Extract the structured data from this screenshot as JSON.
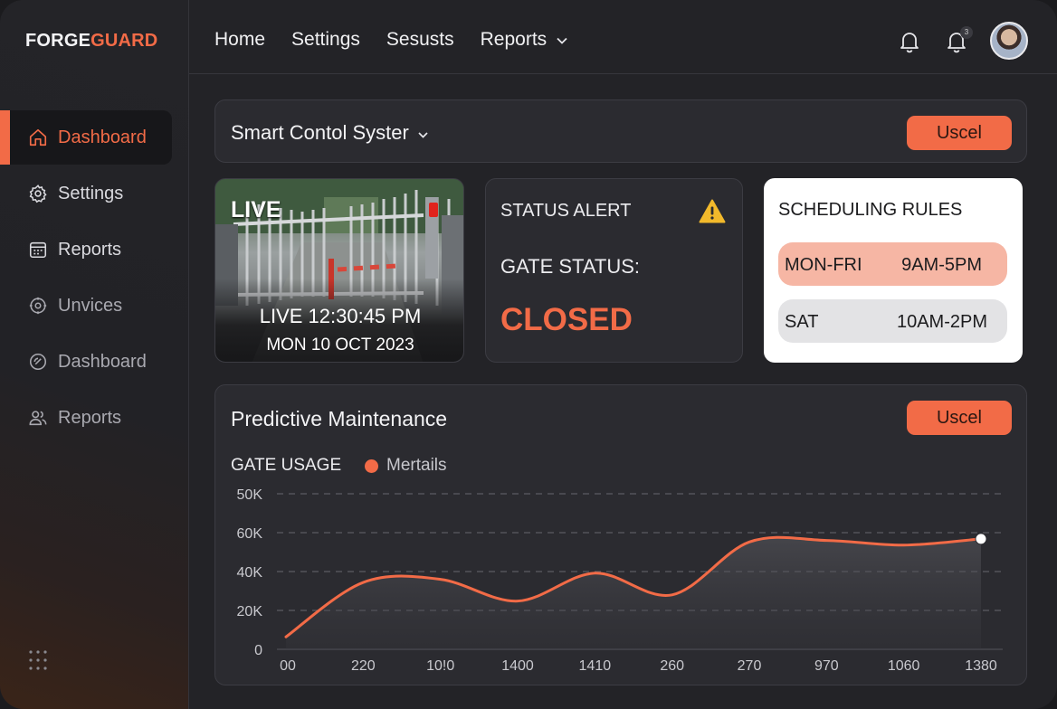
{
  "brand": {
    "part1": "FORGE",
    "part2": "GUARD"
  },
  "sidebar": {
    "items": [
      {
        "label": "Dashboard",
        "icon": "home-icon"
      },
      {
        "label": "Settings",
        "icon": "gear-icon"
      },
      {
        "label": "Reports",
        "icon": "calendar-icon"
      },
      {
        "label": "Unvices",
        "icon": "devices-icon"
      },
      {
        "label": "Dashboard",
        "icon": "gauge-icon"
      },
      {
        "label": "Reports",
        "icon": "users-icon"
      }
    ],
    "bottom_icon": "apps-grid-icon"
  },
  "topnav": {
    "items": [
      "Home",
      "Settings",
      "Sesusts",
      "Reports"
    ],
    "notification_badge": "3"
  },
  "system": {
    "title": "Smart Contol Syster",
    "button": "Uscel"
  },
  "live": {
    "tag": "LIVE",
    "time": "LIVE 12:30:45 PM",
    "date": "MON 10 OCT 2023"
  },
  "status": {
    "title": "STATUS ALERT",
    "gate_label": "GATE STATUS:",
    "gate_value": "CLOSED"
  },
  "schedule": {
    "title": "SCHEDULING RULES",
    "rules": [
      {
        "days": "MON-FRI",
        "hours": "9AM-5PM"
      },
      {
        "days": "SAT",
        "hours": "10AM-2PM"
      }
    ]
  },
  "maintenance": {
    "title": "Predictive Maintenance",
    "button": "Uscel",
    "usage_label": "GATE USAGE"
  },
  "colors": {
    "accent": "#f26b47",
    "panel": "#2b2b30",
    "background": "#232327"
  },
  "chart_data": {
    "type": "area",
    "categories": [
      "00",
      "220",
      "10!0",
      "1400",
      "1410",
      "260",
      "270",
      "970",
      "1060",
      "1380"
    ],
    "ytick_labels": [
      "50K",
      "60K",
      "40K",
      "20K",
      "0"
    ],
    "ylim": [
      0,
      100
    ],
    "grid": true,
    "legend": "top-left",
    "series": [
      {
        "name": "Mertails",
        "color": "#f26b47",
        "values": [
          8,
          43,
          45,
          31,
          49,
          35,
          69,
          70,
          67,
          71
        ]
      }
    ]
  }
}
